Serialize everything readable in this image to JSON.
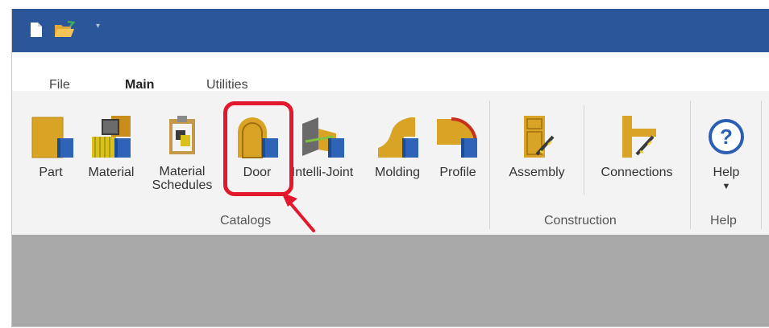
{
  "window": {
    "qat": [
      {
        "name": "new-document",
        "icon": "new-document-icon"
      },
      {
        "name": "open-folder",
        "icon": "open-folder-icon"
      },
      {
        "name": "customize-qat",
        "icon": "chevron-down-icon"
      }
    ],
    "qat_more_glyph": "▾"
  },
  "tabs": [
    {
      "label": "File",
      "active": false
    },
    {
      "label": "Main",
      "active": true
    },
    {
      "label": "Utilities",
      "active": false
    }
  ],
  "ribbon": {
    "groups": [
      {
        "label": "Catalogs",
        "buttons": [
          {
            "label": "Part",
            "icon": "part-icon"
          },
          {
            "label": "Material",
            "icon": "material-icon"
          },
          {
            "label_line1": "Material",
            "label_line2": "Schedules",
            "icon": "material-schedules-icon"
          },
          {
            "label": "Door",
            "icon": "door-icon",
            "highlighted": true
          },
          {
            "label": "Intelli-Joint",
            "icon": "intelli-joint-icon"
          },
          {
            "label": "Molding",
            "icon": "molding-icon"
          },
          {
            "label": "Profile",
            "icon": "profile-icon"
          }
        ]
      },
      {
        "label": "Construction",
        "buttons": [
          {
            "label": "Assembly",
            "icon": "assembly-icon"
          },
          {
            "label": "Connections",
            "icon": "connections-icon"
          }
        ]
      },
      {
        "label": "Help",
        "buttons": [
          {
            "label": "Help",
            "icon": "help-icon",
            "dropdown_glyph": "▼"
          }
        ]
      }
    ]
  },
  "colors": {
    "titlebar": "#2b579a",
    "accent": "#2b579a",
    "highlight": "#e3182d",
    "icon_gold": "#d9a326",
    "icon_book": "#2e63b8",
    "workspace": "#a8a8a8"
  }
}
